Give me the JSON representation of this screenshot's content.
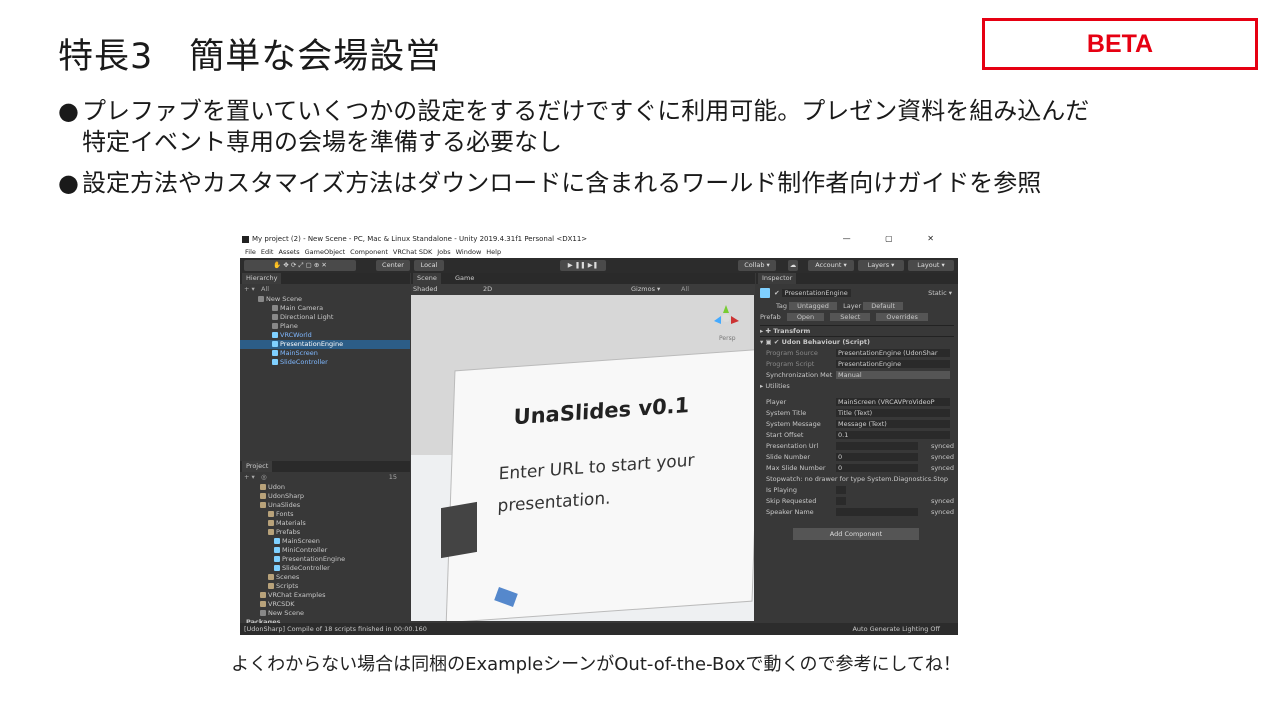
{
  "slide": {
    "title": "特長3　簡単な会場設営",
    "badge": "BETA",
    "bullets": [
      {
        "line1": "プレファブを置いていくつかの設定をするだけですぐに利用可能。プレゼン資料を組み込んだ",
        "line2": "特定イベント専用の会場を準備する必要なし"
      },
      {
        "line1": "設定方法やカスタマイズ方法はダウンロードに含まれるワールド制作者向けガイドを参照",
        "line2": ""
      }
    ],
    "bullet_mark": "●",
    "caption": "よくわからない場合は同梱のExampleシーンがOut-of-the-Boxで動くので参考にしてね！"
  },
  "unity": {
    "window_title": "My project (2) - New Scene - PC, Mac & Linux Standalone - Unity 2019.4.31f1 Personal <DX11>",
    "window_controls": "—  ▢  ✕",
    "menu": [
      "File",
      "Edit",
      "Assets",
      "GameObject",
      "Component",
      "VRChat SDK",
      "Jobs",
      "Window",
      "Help"
    ],
    "toolbar": {
      "pivot": "Center",
      "space": "Local",
      "collab": "Collab ▾",
      "account": "Account ▾",
      "layers": "Layers ▾",
      "layout": "Layout ▾"
    },
    "hierarchy": {
      "tab": "Hierarchy",
      "search": "All",
      "items": [
        "New Scene",
        "Main Camera",
        "Directional Light",
        "Plane",
        "VRCWorld",
        "PresentationEngine",
        "MainScreen",
        "SlideController"
      ]
    },
    "project": {
      "tab": "Project",
      "count": "15",
      "items": [
        "Udon",
        "UdonSharp",
        "UnaSlides",
        "Fonts",
        "Materials",
        "Prefabs",
        "MainScreen",
        "MiniController",
        "PresentationEngine",
        "SlideController",
        "Scenes",
        "Scripts",
        "VRChat Examples",
        "VRCSDK",
        "New Scene",
        "Packages"
      ]
    },
    "scene": {
      "tabs": [
        "Scene",
        "Game"
      ],
      "shading": "Shaded",
      "mode": "2D",
      "gizmos": "Gizmos ▾",
      "search": "All",
      "persp": "Persp",
      "slide_title": "UnaSlides v0.1",
      "slide_text": "Enter URL to start your presentation."
    },
    "inspector": {
      "tab": "Inspector",
      "object_name": "PresentationEngine",
      "static": "Static ▾",
      "tag_label": "Tag",
      "tag": "Untagged",
      "layer_label": "Layer",
      "layer": "Default",
      "prefab_label": "Prefab",
      "prefab_open": "Open",
      "prefab_select": "Select",
      "prefab_overrides": "Overrides",
      "transform": "Transform",
      "udon": "Udon Behaviour (Script)",
      "rows": [
        {
          "label": "Program Source",
          "value": "PresentationEngine (UdonShar"
        },
        {
          "label": "Program Script",
          "value": "PresentationEngine"
        },
        {
          "label": "Synchronization Met",
          "value": "Manual"
        },
        {
          "label": "Utilities",
          "value": ""
        },
        {
          "label": "Player",
          "value": "MainScreen (VRCAVProVideoP"
        },
        {
          "label": "System Title",
          "value": "Title (Text)"
        },
        {
          "label": "System Message",
          "value": "Message (Text)"
        },
        {
          "label": "Start Offset",
          "value": "0.1"
        },
        {
          "label": "Presentation Url",
          "value": "",
          "note": "synced"
        },
        {
          "label": "Slide Number",
          "value": "0",
          "note": "synced"
        },
        {
          "label": "Max Slide Number",
          "value": "0",
          "note": "synced"
        },
        {
          "label": "Stopwatch: no drawer for type System.Diagnostics.Stop",
          "value": ""
        },
        {
          "label": "Is Playing",
          "value": ""
        },
        {
          "label": "Skip Requested",
          "value": "",
          "note": "synced"
        },
        {
          "label": "Speaker Name",
          "value": "",
          "note": "synced"
        }
      ],
      "add_component": "Add Component"
    },
    "status_left": "[UdonSharp] Compile of 18 scripts finished in 00:00.160",
    "status_right": "Auto Generate Lighting Off"
  }
}
